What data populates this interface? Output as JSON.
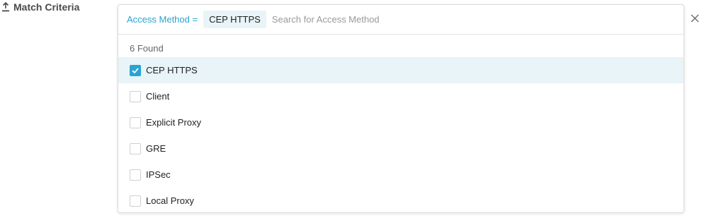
{
  "section": {
    "title": "Match Criteria",
    "icon": "upload-icon"
  },
  "filter": {
    "key_label": "Access Method =",
    "chip_label": "CEP HTTPS",
    "search_value": "",
    "search_placeholder": "Search for Access Method"
  },
  "results": {
    "count_label": "6 Found",
    "options": [
      {
        "label": "CEP HTTPS",
        "checked": true
      },
      {
        "label": "Client",
        "checked": false
      },
      {
        "label": "Explicit Proxy",
        "checked": false
      },
      {
        "label": "GRE",
        "checked": false
      },
      {
        "label": "IPSec",
        "checked": false
      },
      {
        "label": "Local Proxy",
        "checked": false
      }
    ]
  },
  "colors": {
    "accent": "#2aa3d4",
    "selected_row": "#e8f4f8"
  },
  "close_icon": "close-icon"
}
